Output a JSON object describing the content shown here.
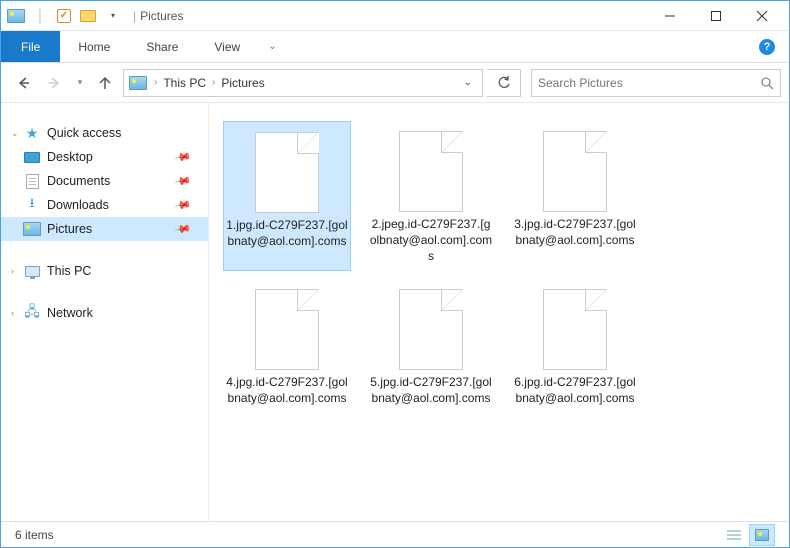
{
  "window": {
    "title": "Pictures"
  },
  "ribbon": {
    "file": "File",
    "tabs": [
      "Home",
      "Share",
      "View"
    ]
  },
  "breadcrumb": {
    "segments": [
      "This PC",
      "Pictures"
    ]
  },
  "search": {
    "placeholder": "Search Pictures"
  },
  "sidebar": {
    "quick_access": "Quick access",
    "items": [
      {
        "label": "Desktop",
        "icon": "desktop",
        "pinned": true
      },
      {
        "label": "Documents",
        "icon": "doc",
        "pinned": true
      },
      {
        "label": "Downloads",
        "icon": "down",
        "pinned": true
      },
      {
        "label": "Pictures",
        "icon": "pictures",
        "pinned": true,
        "selected": true
      }
    ],
    "this_pc": "This PC",
    "network": "Network"
  },
  "files": [
    {
      "name": "1.jpg.id-C279F237.[golbnaty@aol.com].coms",
      "selected": true
    },
    {
      "name": "2.jpeg.id-C279F237.[golbnaty@aol.com].coms"
    },
    {
      "name": "3.jpg.id-C279F237.[golbnaty@aol.com].coms"
    },
    {
      "name": "4.jpg.id-C279F237.[golbnaty@aol.com].coms"
    },
    {
      "name": "5.jpg.id-C279F237.[golbnaty@aol.com].coms"
    },
    {
      "name": "6.jpg.id-C279F237.[golbnaty@aol.com].coms"
    }
  ],
  "status": {
    "count": "6 items"
  }
}
